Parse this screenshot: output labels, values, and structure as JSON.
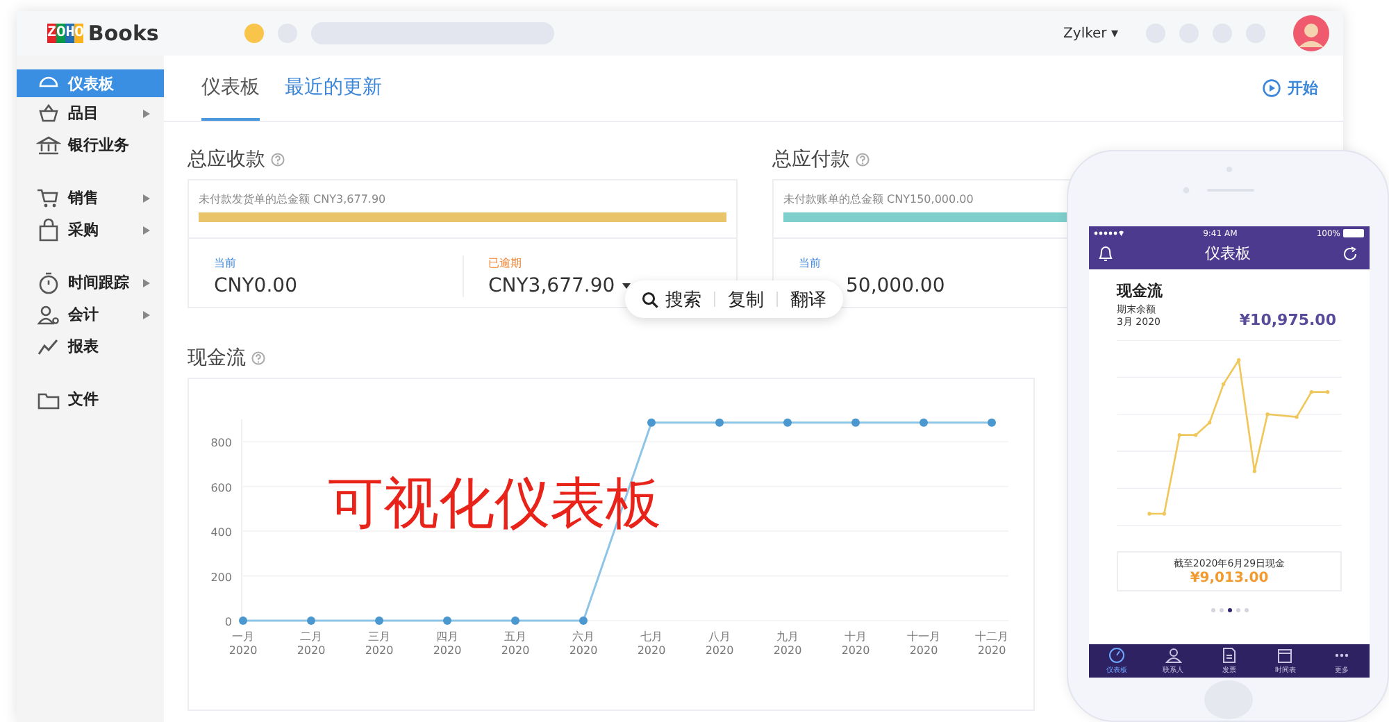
{
  "header": {
    "logo_letters": "ZOHO",
    "logo_text": "Books",
    "user": "Zylker ▾"
  },
  "sidebar": {
    "groups": [
      [
        {
          "label": "仪表板",
          "selected": true,
          "has_submenu": false
        },
        {
          "label": "品目",
          "selected": false,
          "has_submenu": true
        },
        {
          "label": "银行业务",
          "selected": false,
          "has_submenu": false
        }
      ],
      [
        {
          "label": "销售",
          "selected": false,
          "has_submenu": true
        },
        {
          "label": "采购",
          "selected": false,
          "has_submenu": true
        }
      ],
      [
        {
          "label": "时间跟踪",
          "selected": false,
          "has_submenu": true
        },
        {
          "label": "会计",
          "selected": false,
          "has_submenu": true
        },
        {
          "label": "报表",
          "selected": false,
          "has_submenu": false
        }
      ],
      [
        {
          "label": "文件",
          "selected": false,
          "has_submenu": false
        }
      ]
    ]
  },
  "tabs": [
    {
      "label": "仪表板",
      "selected": true
    },
    {
      "label": "最近的更新",
      "selected": false
    }
  ],
  "start_link": "开始",
  "summaries": [
    {
      "title": "总应收款",
      "bar_label": "未付款发货单的总金额 CNY3,677.90",
      "color": "#e9c46a",
      "columns": [
        {
          "kind": "current",
          "label": "当前",
          "value": "CNY0.00",
          "dropdown": false
        },
        {
          "kind": "overdue",
          "label": "已逾期",
          "value": "CNY3,677.90",
          "dropdown": true
        }
      ]
    },
    {
      "title": "总应付款",
      "bar_label": "未付款账单的总金额 CNY150,000.00",
      "color": "#7fcfcc",
      "columns": [
        {
          "kind": "current",
          "label": "当前",
          "value": "50,000.00",
          "dropdown": false
        }
      ]
    }
  ],
  "cashflow": {
    "title": "现金流",
    "chart_data": {
      "type": "line",
      "categories": [
        "一月 2020",
        "二月 2020",
        "三月 2020",
        "四月 2020",
        "五月 2020",
        "六月 2020",
        "七月 2020",
        "八月 2020",
        "九月 2020",
        "十月 2020",
        "十一月 2020",
        "十二月 2020"
      ],
      "series": [
        {
          "color": "#8ec5e6",
          "marker": "circle",
          "values": [
            0,
            0,
            0,
            0,
            0,
            0,
            885,
            885,
            885,
            885,
            885,
            885
          ]
        }
      ],
      "grid": true,
      "ylim": [
        0,
        900
      ],
      "yticks": [
        0,
        200,
        400,
        600,
        800
      ]
    }
  },
  "overlay_caption": "可视化仪表板",
  "selection_popup": [
    {
      "kind": "search",
      "label": "搜索"
    },
    {
      "kind": "plain",
      "label": "复制"
    },
    {
      "kind": "plain",
      "label": "翻译"
    }
  ],
  "phone": {
    "time": "9:41 AM",
    "battery": "100%",
    "title": "仪表板",
    "card_title": "现金流",
    "balance_label": "期末余额",
    "period": "3月 2020",
    "balance": "¥10,975.00",
    "footer_label": "截至2020年6月29日现金",
    "footer_amount": "¥9,013.00",
    "pager": [
      {
        "selected": false
      },
      {
        "selected": false
      },
      {
        "selected": true
      },
      {
        "selected": false
      },
      {
        "selected": false
      }
    ],
    "tabs": [
      {
        "label": "仪表板",
        "selected": true
      },
      {
        "label": "联系人",
        "selected": false
      },
      {
        "label": "发票",
        "selected": false
      },
      {
        "label": "时间表",
        "selected": false
      },
      {
        "label": "更多",
        "selected": false
      }
    ]
  }
}
